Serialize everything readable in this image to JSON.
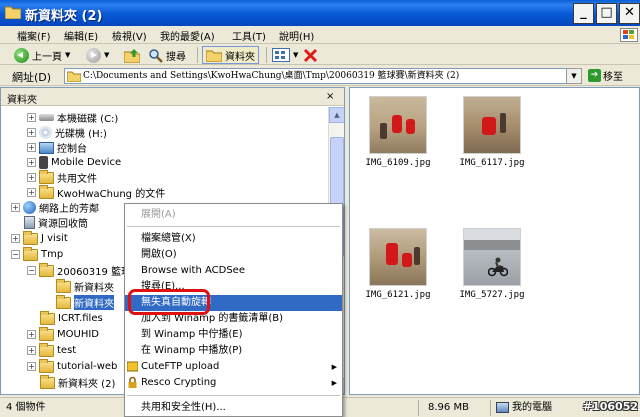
{
  "window": {
    "title": "新資料夾 (2)"
  },
  "menubar": {
    "items": [
      "檔案(F)",
      "編輯(E)",
      "檢視(V)",
      "我的最愛(A)",
      "工具(T)",
      "說明(H)"
    ]
  },
  "toolbar": {
    "back_label": "上一頁",
    "search_label": "搜尋",
    "folders_label": "資料夾"
  },
  "addressbar": {
    "label": "網址(D)",
    "path": "C:\\Documents and Settings\\KwoHwaChung\\桌面\\Tmp\\20060319 籃球賽\\新資料夾 (2)",
    "go_label": "移至"
  },
  "folders_pane": {
    "title": "資料夾",
    "close": "×",
    "tree": [
      {
        "label": "本機磁碟 (C:)",
        "icon": "drive-icon"
      },
      {
        "label": "光碟機 (H:)",
        "icon": "cd-drive-icon"
      },
      {
        "label": "控制台",
        "icon": "control-panel-icon"
      },
      {
        "label": "Mobile Device",
        "icon": "mobile-device-icon"
      },
      {
        "label": "共用文件",
        "icon": "folder-icon"
      },
      {
        "label": "KwoHwaChung 的文件",
        "icon": "folder-icon"
      },
      {
        "label": "網路上的芳鄰",
        "icon": "network-icon"
      },
      {
        "label": "資源回收筒",
        "icon": "recycle-bin-icon"
      },
      {
        "label": "J visit",
        "icon": "folder-icon"
      },
      {
        "label": "Tmp",
        "icon": "folder-icon"
      },
      {
        "label": "20060319 籃球",
        "icon": "folder-icon"
      },
      {
        "label": "新資料夾",
        "icon": "folder-icon"
      },
      {
        "label": "新資料夾",
        "icon": "folder-icon"
      },
      {
        "label": "ICRT.files",
        "icon": "folder-icon"
      },
      {
        "label": "MOUHID",
        "icon": "folder-icon"
      },
      {
        "label": "test",
        "icon": "folder-icon"
      },
      {
        "label": "tutorial-web",
        "icon": "folder-icon"
      },
      {
        "label": "新資料夾 (2)",
        "icon": "folder-icon"
      }
    ]
  },
  "files": [
    {
      "name": "IMG_6109.jpg"
    },
    {
      "name": "IMG_6117.jpg"
    },
    {
      "name": "IMG_6121.jpg"
    },
    {
      "name": "IMG_5727.jpg"
    }
  ],
  "context_menu": {
    "items": [
      {
        "label": "展開(A)",
        "state": "disabled"
      },
      {
        "label": "檔案總管(X)"
      },
      {
        "label": "開啟(O)"
      },
      {
        "label": "Browse with ACDSee"
      },
      {
        "label": "搜尋(E)..."
      },
      {
        "label": "無失真自動旋轉",
        "state": "selected"
      },
      {
        "label": "加入到 Winamp 的書籤清單(B)"
      },
      {
        "label": "到 Winamp 中佇播(E)"
      },
      {
        "label": "在 Winamp 中播放(P)"
      },
      {
        "label": "CuteFTP upload",
        "submenu": true
      },
      {
        "label": "Resco Crypting",
        "submenu": true
      },
      {
        "label": "共用和安全性(H)..."
      }
    ]
  },
  "statusbar": {
    "count": "4 個物件",
    "size": "8.96 MB",
    "location": "我的電腦",
    "watermark": "#106052"
  },
  "colors": {
    "title_bar": "#0858d6",
    "selection": "#316ac5",
    "annotation_circle": "#e01010"
  }
}
